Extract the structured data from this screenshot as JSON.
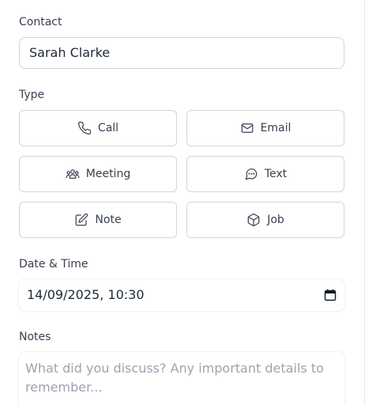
{
  "contact": {
    "label": "Contact",
    "value": "Sarah Clarke"
  },
  "type": {
    "label": "Type",
    "options": [
      {
        "label": "Call",
        "icon": "phone-icon"
      },
      {
        "label": "Email",
        "icon": "mail-icon"
      },
      {
        "label": "Meeting",
        "icon": "users-icon"
      },
      {
        "label": "Text",
        "icon": "message-icon"
      },
      {
        "label": "Note",
        "icon": "edit-icon"
      },
      {
        "label": "Job",
        "icon": "box-icon"
      }
    ]
  },
  "datetime": {
    "label": "Date & Time",
    "value": "14/09/2025, 10:30",
    "icon": "calendar-icon"
  },
  "notes": {
    "label": "Notes",
    "placeholder": "What did you discuss? Any important details to remember..."
  },
  "colors": {
    "border": "#d1d5db",
    "text": "#374151",
    "placeholder": "#9ca3af"
  }
}
